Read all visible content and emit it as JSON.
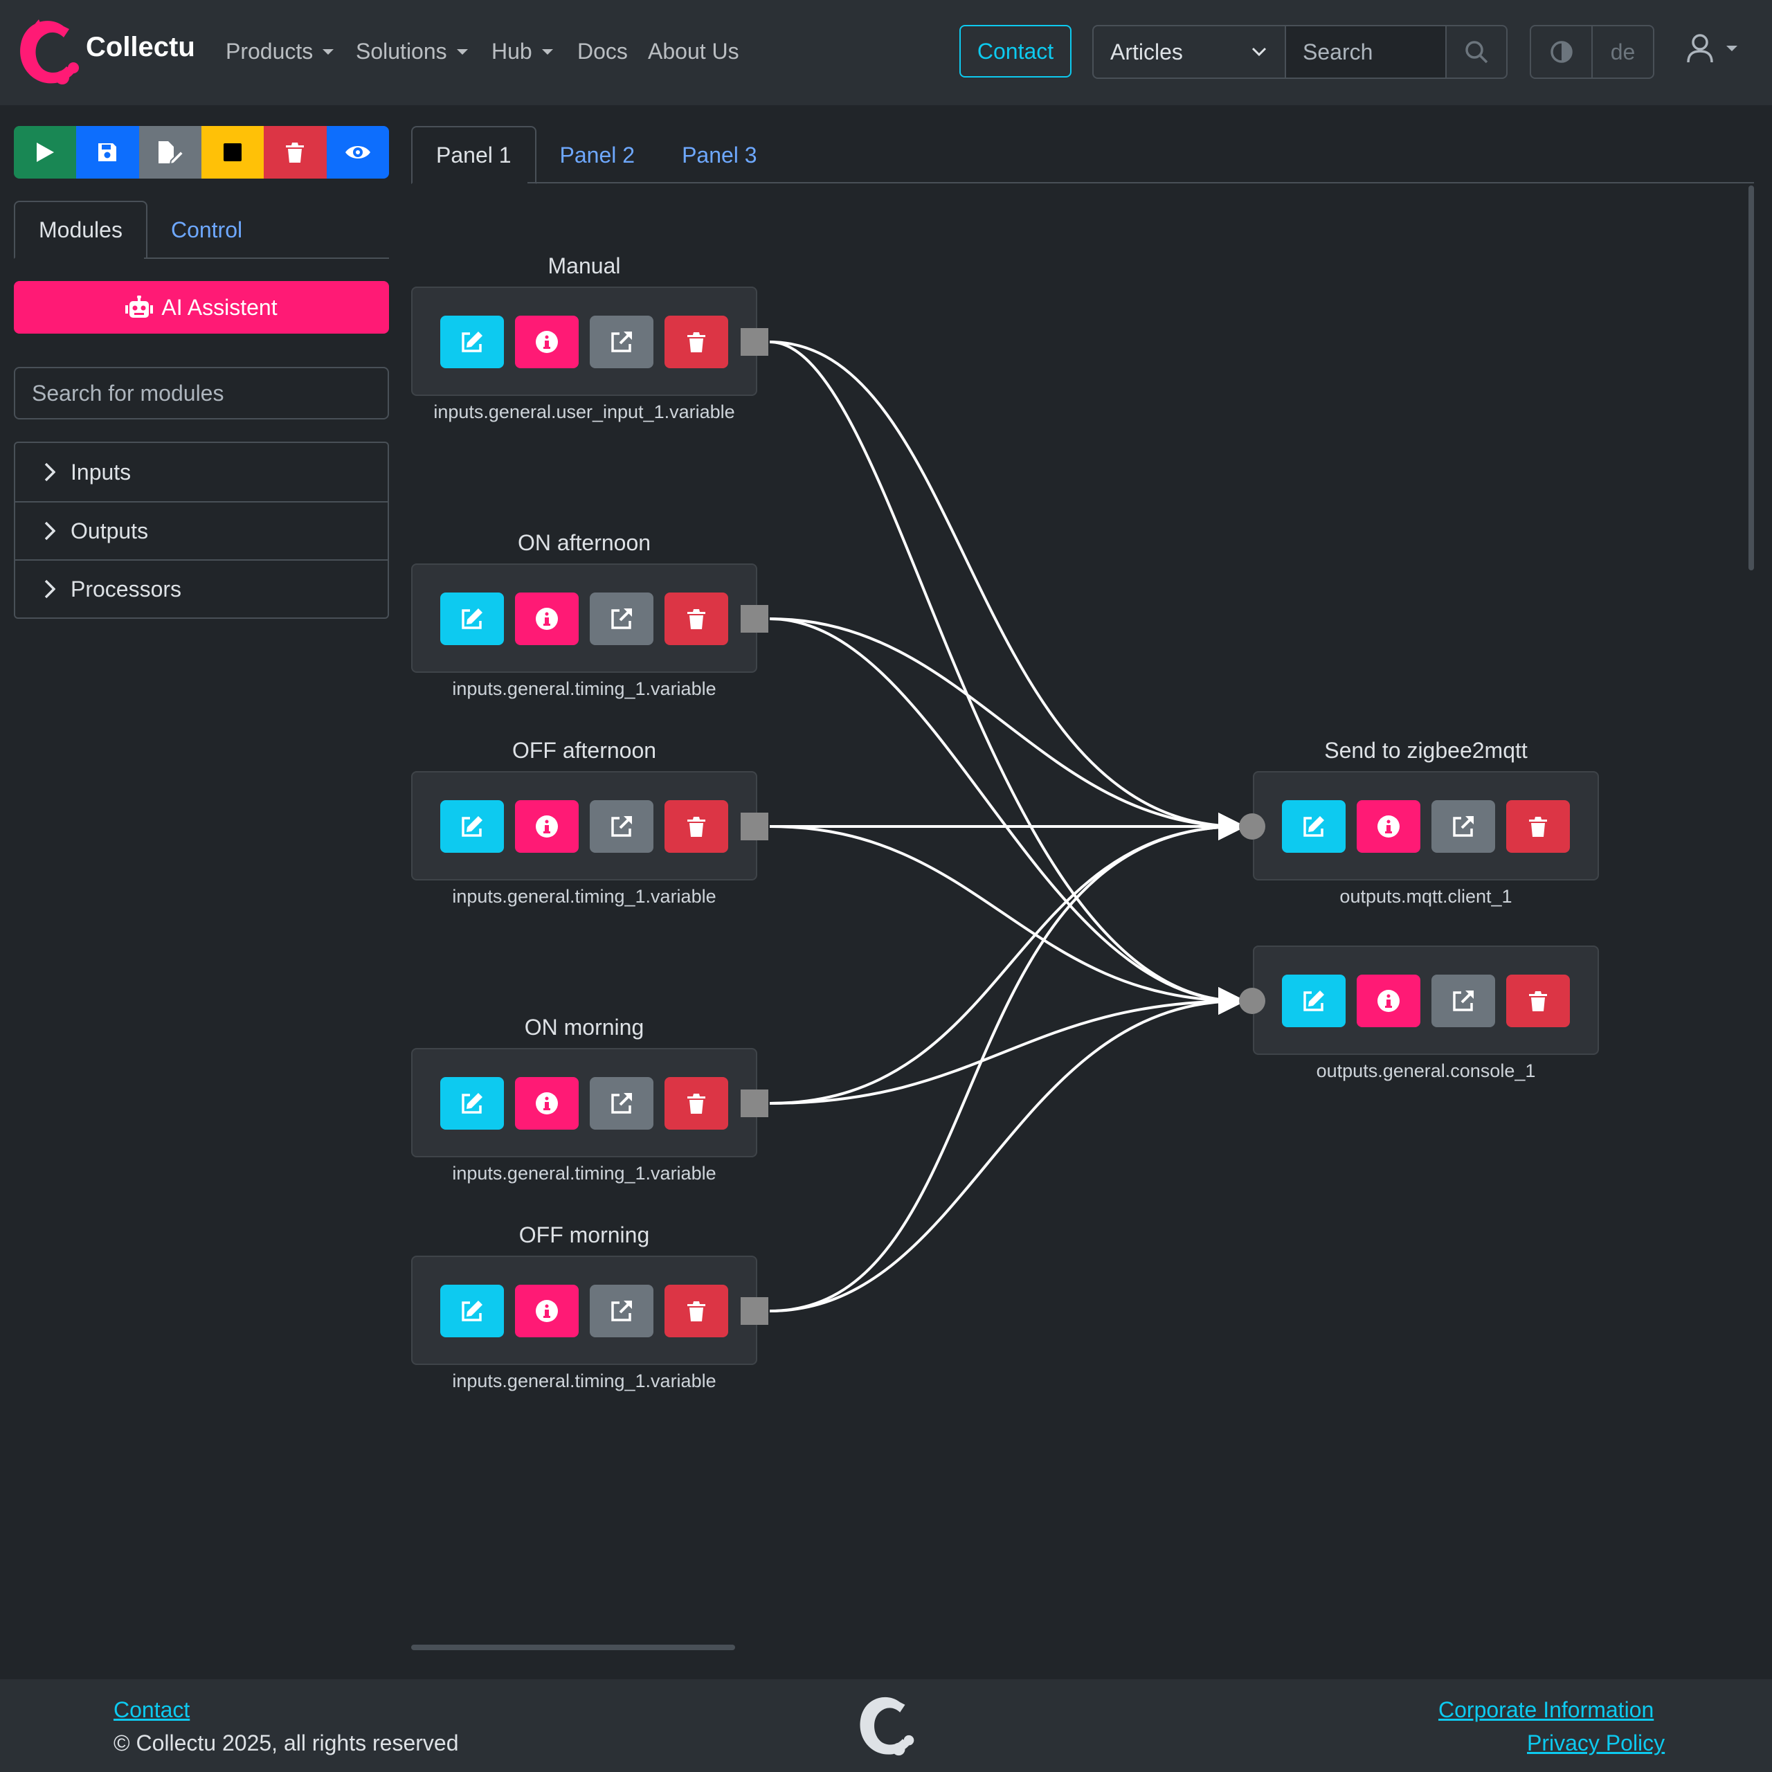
{
  "header": {
    "brand": "Collectu",
    "nav": [
      {
        "label": "Products",
        "dropdown": true
      },
      {
        "label": "Solutions",
        "dropdown": true
      },
      {
        "label": "Hub",
        "dropdown": true
      },
      {
        "label": "Docs",
        "dropdown": false
      },
      {
        "label": "About Us",
        "dropdown": false
      }
    ],
    "contact": "Contact",
    "search_select": "Articles",
    "search_placeholder": "Search",
    "lang": "de"
  },
  "sidebar": {
    "tabs": [
      "Modules",
      "Control"
    ],
    "ai_button": "AI Assistent",
    "search_placeholder": "Search for modules",
    "sections": [
      "Inputs",
      "Outputs",
      "Processors"
    ]
  },
  "canvas": {
    "tabs": [
      "Panel 1",
      "Panel 2",
      "Panel 3"
    ],
    "nodes": [
      {
        "title": "Manual",
        "module": "inputs.general.user_input_1.variable"
      },
      {
        "title": "ON afternoon",
        "module": "inputs.general.timing_1.variable"
      },
      {
        "title": "OFF afternoon",
        "module": "inputs.general.timing_1.variable"
      },
      {
        "title": "ON morning",
        "module": "inputs.general.timing_1.variable"
      },
      {
        "title": "OFF morning",
        "module": "inputs.general.timing_1.variable"
      },
      {
        "title": "Send to zigbee2mqtt",
        "module": "outputs.mqtt.client_1"
      },
      {
        "title": "",
        "module": "outputs.general.console_1"
      }
    ]
  },
  "footer": {
    "contact": "Contact",
    "copyright": "© Collectu 2025, all rights reserved",
    "corporate": "Corporate Information",
    "privacy": "Privacy Policy"
  },
  "colors": {
    "accent": "#0dcaf0",
    "brand": "#ff1a75",
    "danger": "#dc3545",
    "success": "#198754",
    "primary": "#0d6efd",
    "warning": "#ffc107",
    "secondary": "#6c757d"
  }
}
